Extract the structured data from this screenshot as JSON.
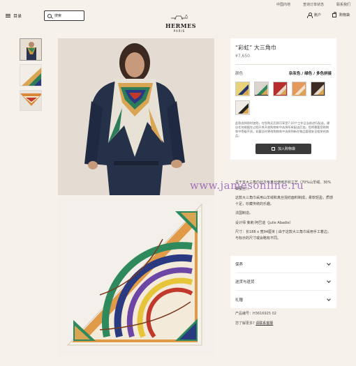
{
  "utility_links": [
    "中国内地",
    "查询订单状态",
    "联系我们"
  ],
  "header": {
    "menu_label": "目录",
    "search_placeholder": "搜索",
    "brand": "HERMES",
    "brand_city": "PARIS",
    "account_label": "账户",
    "cart_label": "购物袋"
  },
  "product": {
    "title": "“彩虹” 大三角巾",
    "price": "¥7,650",
    "color_label": "颜色",
    "color_value": "杂灰色 / 绿色 / 多色拼接",
    "swatches": [
      {
        "name": "yellow-navy",
        "bg": "#e8d37a",
        "accent": "#23356e",
        "selected": false
      },
      {
        "name": "grey-green",
        "bg": "#d9d4cc",
        "accent": "#2e8a5c",
        "selected": true
      },
      {
        "name": "red-multi",
        "bg": "#b52d2d",
        "accent": "#e8d7c8",
        "selected": false
      },
      {
        "name": "orange-multi",
        "bg": "#e49a5a",
        "accent": "#f2e2cf",
        "selected": false
      },
      {
        "name": "brown-multi",
        "bg": "#3d2b25",
        "accent": "#e9d9c9",
        "selected": false
      },
      {
        "name": "black-white",
        "bg": "#f0ece5",
        "accent": "#222222",
        "selected": false
      }
    ],
    "delivery_note": "此款选择即时加购，在您购买后即可享受7-10个工作日当前进行配送。建议任何根据在过程开关开放购物车中选择所有配送后加，您将需要您购物车中等级不同，如要及时更改购物车中选择到新在物品管理安全相关的商品。",
    "add_to_cart": "加入购物袋"
  },
  "description": {
    "paragraphs": [
      "关于本大三角巾此次与真丝使用平织工艺（70%山羊绒、30%桑蚕丝）。",
      "这款大三角巾采用山羊绒和真丝混纺面料制成，柔软轻盈，质感十足，珍藏传统的乐趣。",
      "法国制造。",
      "设计师 茱莉·阿巴迪（Julie Abadie）",
      "尺寸：长188 x 宽94厘米 | 由于这款大三角巾采用手工着边，与标示的尺寸或会略有不同。"
    ]
  },
  "accordion": [
    {
      "label": "保养"
    },
    {
      "label": "送货与退货"
    },
    {
      "label": "礼赠"
    }
  ],
  "meta": {
    "product_code": "产品编号：H3616925 02",
    "help_prefix": "您了解更多?",
    "help_link": "请联系客服"
  },
  "watermark": "www.jamesonline.ru"
}
